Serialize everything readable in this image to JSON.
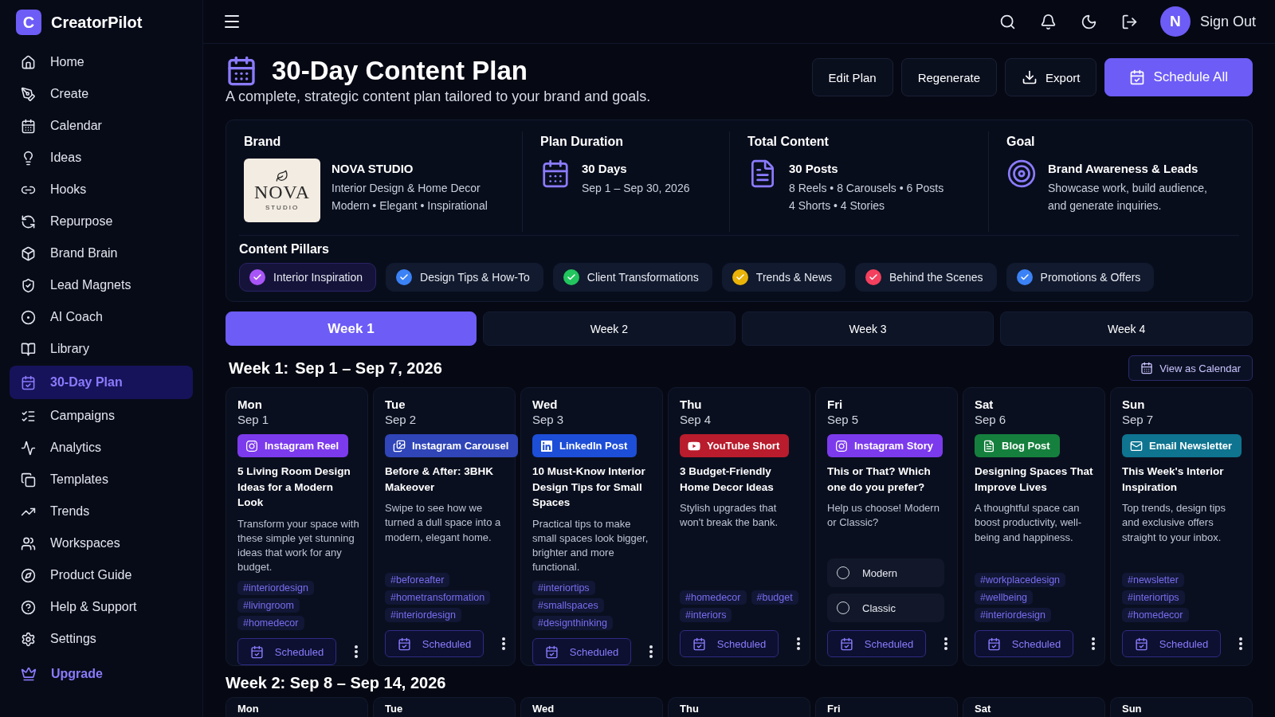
{
  "app": {
    "logo_letter": "C",
    "name": "CreatorPilot"
  },
  "sidebar": {
    "items": [
      {
        "label": "Home",
        "selected": false
      },
      {
        "label": "Create",
        "selected": false
      },
      {
        "label": "Calendar",
        "selected": false
      },
      {
        "label": "Ideas",
        "selected": false
      },
      {
        "label": "Hooks",
        "selected": false
      },
      {
        "label": "Repurpose",
        "selected": false
      },
      {
        "label": "Brand Brain",
        "selected": false
      },
      {
        "label": "Lead Magnets",
        "selected": false
      },
      {
        "label": "AI Coach",
        "selected": false
      },
      {
        "label": "Library",
        "selected": false
      },
      {
        "label": "30-Day Plan",
        "selected": true
      },
      {
        "label": "Campaigns",
        "selected": false
      },
      {
        "label": "Analytics",
        "selected": false
      },
      {
        "label": "Templates",
        "selected": false
      },
      {
        "label": "Trends",
        "selected": false
      },
      {
        "label": "Workspaces",
        "selected": false
      },
      {
        "label": "Product Guide",
        "selected": false
      },
      {
        "label": "Help & Support",
        "selected": false
      },
      {
        "label": "Settings",
        "selected": false
      }
    ],
    "upgrade": "Upgrade"
  },
  "topbar": {
    "avatar_initial": "N",
    "sign_out": "Sign Out"
  },
  "page": {
    "title": "30-Day Content Plan",
    "subtitle": "A complete, strategic content plan tailored to your brand and goals.",
    "buttons": [
      {
        "label": "Edit Plan",
        "kind": "plain"
      },
      {
        "label": "Regenerate",
        "kind": "plain"
      },
      {
        "label": "Export",
        "kind": "export"
      },
      {
        "label": "Schedule All",
        "kind": "primary"
      }
    ]
  },
  "overview": {
    "brand": {
      "heading": "Brand",
      "logo_word": "NOVA",
      "logo_sub": "STUDIO",
      "name": "NOVA STUDIO",
      "line1": "Interior Design & Home Decor",
      "line2": "Modern • Elegant • Inspirational"
    },
    "duration": {
      "heading": "Plan Duration",
      "value": "30 Days",
      "detail": "Sep 1 – Sep 30, 2026"
    },
    "content": {
      "heading": "Total Content",
      "value": "30 Posts",
      "detail": "8 Reels • 8 Carousels • 6 Posts",
      "detail2": "4 Shorts • 4 Stories"
    },
    "goal": {
      "heading": "Goal",
      "value": "Brand Awareness & Leads",
      "detail": "Showcase work, build audience,",
      "detail2": "and generate inquiries."
    },
    "pillars_heading": "Content Pillars",
    "pillars": [
      {
        "label": "Interior Inspiration",
        "color": "#a855f7",
        "selected": true
      },
      {
        "label": "Design Tips & How-To",
        "color": "#3b82f6",
        "selected": false
      },
      {
        "label": "Client Transformations",
        "color": "#22c55e",
        "selected": false
      },
      {
        "label": "Trends & News",
        "color": "#eab308",
        "selected": false
      },
      {
        "label": "Behind the Scenes",
        "color": "#f43f5e",
        "selected": false
      },
      {
        "label": "Promotions & Offers",
        "color": "#3b82f6",
        "selected": false
      }
    ]
  },
  "tabs": [
    {
      "label": "Week 1",
      "selected": true
    },
    {
      "label": "Week 2",
      "selected": false
    },
    {
      "label": "Week 3",
      "selected": false
    },
    {
      "label": "Week 4",
      "selected": false
    }
  ],
  "week": {
    "heading_prefix": "Week 1:",
    "heading_range": "Sep 1 – Sep 7, 2026",
    "view_calendar": "View as Calendar",
    "days": [
      {
        "day": "Mon",
        "date": "Sep 1",
        "kind": "post",
        "type": {
          "label": "Instagram Reel",
          "kind": "reel",
          "color": "#7c3aed"
        },
        "title": "5 Living Room Design Ideas for a Modern Look",
        "body": "Transform your space with these simple yet stunning ideas that work for any budget.",
        "tags": [
          "#interiordesign",
          "#livingroom",
          "#homedecor"
        ],
        "status": "Scheduled"
      },
      {
        "day": "Tue",
        "date": "Sep 2",
        "kind": "post",
        "type": {
          "label": "Instagram Carousel",
          "kind": "carousel",
          "color": "#2f45b8"
        },
        "title": "Before & After: 3BHK Makeover",
        "body": "Swipe to see how we turned a dull space into a modern, elegant home.",
        "tags": [
          "#beforeafter",
          "#hometransformation",
          "#interiordesign"
        ],
        "status": "Scheduled"
      },
      {
        "day": "Wed",
        "date": "Sep 3",
        "kind": "post",
        "type": {
          "label": "LinkedIn Post",
          "kind": "linkedin",
          "color": "#1d4ed8"
        },
        "title": "10 Must-Know Interior Design Tips for Small Spaces",
        "body": "Practical tips to make small spaces look bigger, brighter and more functional.",
        "tags": [
          "#interiortips",
          "#smallspaces",
          "#designthinking"
        ],
        "status": "Scheduled"
      },
      {
        "day": "Thu",
        "date": "Sep 4",
        "kind": "post",
        "type": {
          "label": "YouTube Short",
          "kind": "youtube",
          "color": "#b91c2c"
        },
        "title": "3 Budget-Friendly Home Decor Ideas",
        "body": "Stylish upgrades that won't break the bank.",
        "tags": [
          "#homedecor",
          "#budget",
          "#interiors"
        ],
        "status": "Scheduled"
      },
      {
        "day": "Fri",
        "date": "Sep 5",
        "kind": "poll",
        "type": {
          "label": "Instagram Story",
          "kind": "story",
          "color": "#7c3aed"
        },
        "title": "This or That? Which one do you prefer?",
        "body": "Help us choose! Modern or Classic?",
        "options": [
          {
            "label": "Modern",
            "selected": false
          },
          {
            "label": "Classic",
            "selected": false
          }
        ],
        "status": "Scheduled"
      },
      {
        "day": "Sat",
        "date": "Sep 6",
        "kind": "post",
        "type": {
          "label": "Blog Post",
          "kind": "blog",
          "color": "#15803d"
        },
        "title": "Designing Spaces That Improve Lives",
        "body": "A thoughtful space can boost productivity, well-being and happiness.",
        "tags": [
          "#workplacedesign",
          "#wellbeing",
          "#interiordesign"
        ],
        "status": "Scheduled"
      },
      {
        "day": "Sun",
        "date": "Sep 7",
        "kind": "post",
        "type": {
          "label": "Email Newsletter",
          "kind": "email",
          "color": "#0e7490"
        },
        "title": "This Week's Interior Inspiration",
        "body": "Top trends, design tips and exclusive offers straight to your inbox.",
        "tags": [
          "#newsletter",
          "#interiortips",
          "#homedecor"
        ],
        "status": "Scheduled"
      }
    ]
  },
  "next_week": {
    "heading": "Week 2: Sep 8 – Sep 14, 2026",
    "days": [
      "Mon",
      "Tue",
      "Wed",
      "Thu",
      "Fri",
      "Sat",
      "Sun"
    ]
  }
}
